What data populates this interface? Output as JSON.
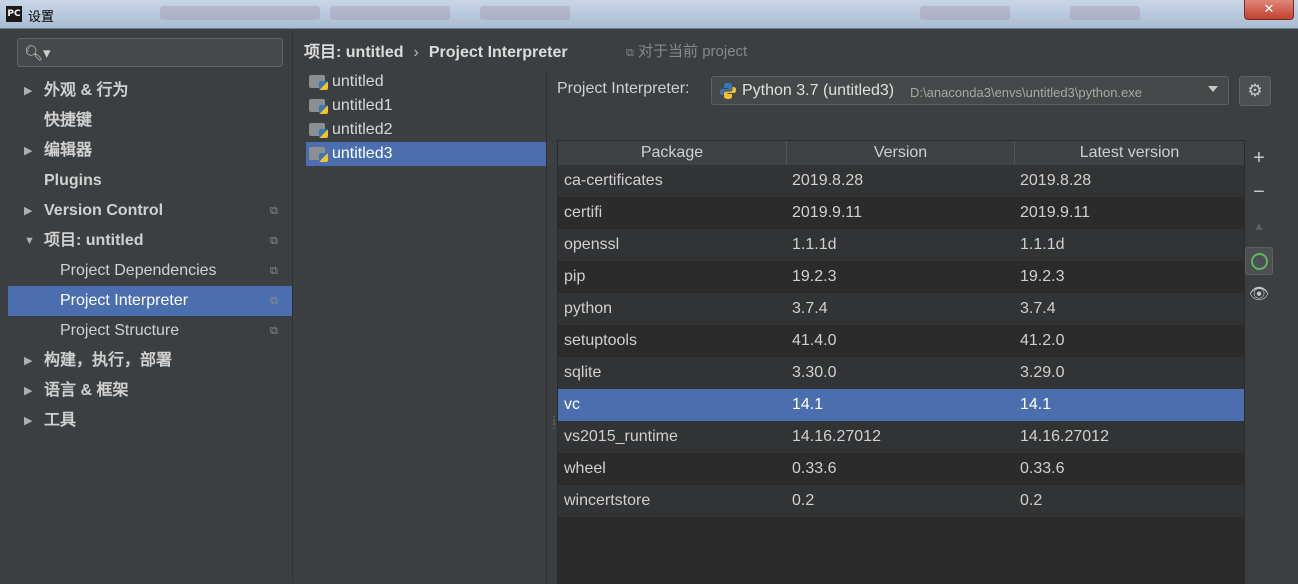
{
  "window": {
    "title": "设置",
    "app_icon": "PC"
  },
  "sidebar": {
    "items": [
      {
        "label": "外观 & 行为",
        "expandable": true,
        "expanded": false
      },
      {
        "label": "快捷键",
        "expandable": false
      },
      {
        "label": "编辑器",
        "expandable": true,
        "expanded": false
      },
      {
        "label": "Plugins",
        "expandable": false
      },
      {
        "label": "Version Control",
        "expandable": true,
        "expanded": false,
        "project_scoped": true
      },
      {
        "label": "项目: untitled",
        "expandable": true,
        "expanded": true,
        "project_scoped": true
      },
      {
        "label": "Project Dependencies",
        "child": true,
        "project_scoped": true
      },
      {
        "label": "Project Interpreter",
        "child": true,
        "project_scoped": true,
        "selected": true
      },
      {
        "label": "Project Structure",
        "child": true,
        "project_scoped": true
      },
      {
        "label": "构建，执行，部署",
        "expandable": true,
        "expanded": false
      },
      {
        "label": "语言 & 框架",
        "expandable": true,
        "expanded": false
      },
      {
        "label": "工具",
        "expandable": true,
        "expanded": false
      }
    ]
  },
  "breadcrumb": {
    "parent": "项目: untitled",
    "separator": "›",
    "current": "Project Interpreter",
    "scope_note": "对于当前 project"
  },
  "projects": [
    "untitled",
    "untitled1",
    "untitled2",
    "untitled3"
  ],
  "selected_project": "untitled3",
  "interpreter": {
    "label": "Project Interpreter:",
    "name": "Python 3.7 (untitled3)",
    "path": "D:\\anaconda3\\envs\\untitled3\\python.exe"
  },
  "table": {
    "columns": [
      "Package",
      "Version",
      "Latest version"
    ],
    "rows": [
      [
        "ca-certificates",
        "2019.8.28",
        "2019.8.28"
      ],
      [
        "certifi",
        "2019.9.11",
        "2019.9.11"
      ],
      [
        "openssl",
        "1.1.1d",
        "1.1.1d"
      ],
      [
        "pip",
        "19.2.3",
        "19.2.3"
      ],
      [
        "python",
        "3.7.4",
        "3.7.4"
      ],
      [
        "setuptools",
        "41.4.0",
        "41.2.0"
      ],
      [
        "sqlite",
        "3.30.0",
        "3.29.0"
      ],
      [
        "vc",
        "14.1",
        "14.1"
      ],
      [
        "vs2015_runtime",
        "14.16.27012",
        "14.16.27012"
      ],
      [
        "wheel",
        "0.33.6",
        "0.33.6"
      ],
      [
        "wincertstore",
        "0.2",
        "0.2"
      ]
    ],
    "selected_row": "vc"
  },
  "toolbar": {
    "add_icon": "plus-icon",
    "remove_icon": "minus-icon",
    "upgrade_icon": "up-arrow-icon",
    "conda_icon": "ring-icon",
    "show_icon": "eye-icon"
  },
  "colors": {
    "accent_selection": "#4b6eaf",
    "background": "#3c3f41",
    "table_bg": "#2b2b2b"
  }
}
